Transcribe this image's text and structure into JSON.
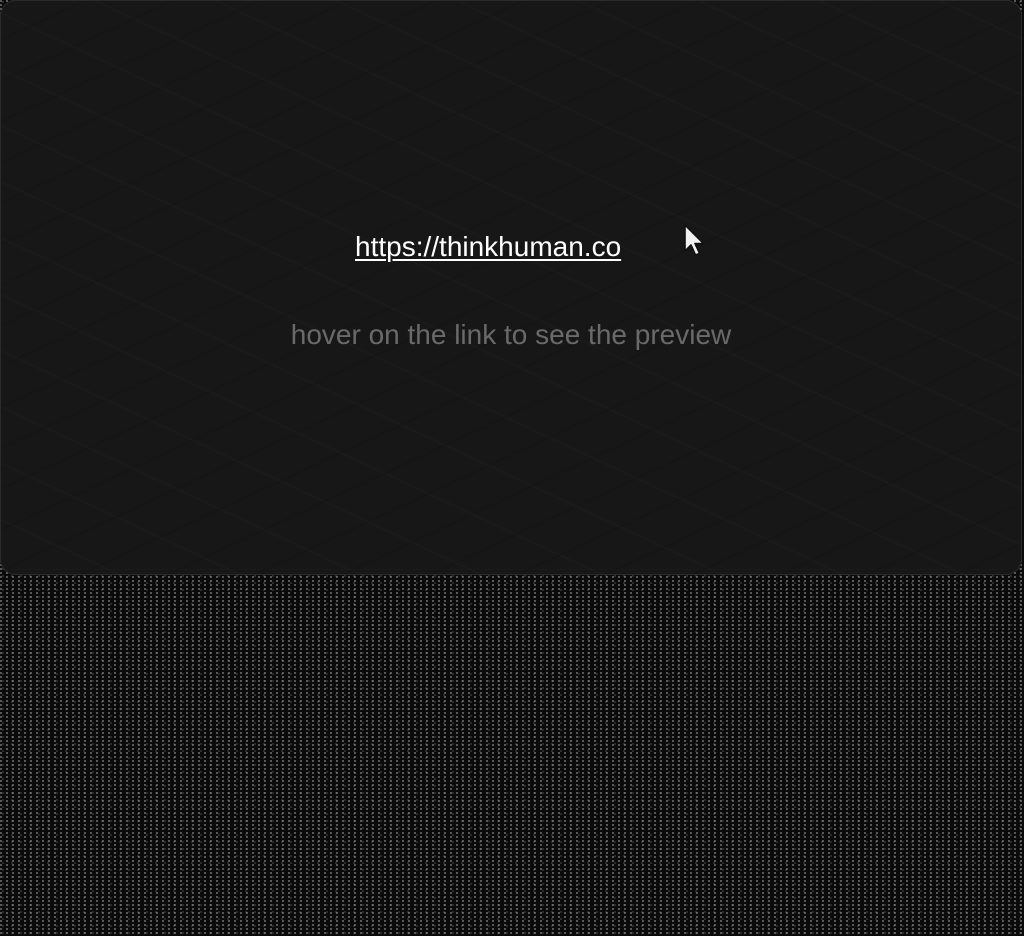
{
  "card": {
    "link_text": "https://thinkhuman.co",
    "hint_text": "hover on the link to see the preview"
  },
  "cursor": {
    "icon": "mouse-pointer-icon"
  },
  "colors": {
    "card_background": "#171717",
    "page_background": "#0b0b0b",
    "link": "#ffffff",
    "hint": "#6a6a6a"
  }
}
